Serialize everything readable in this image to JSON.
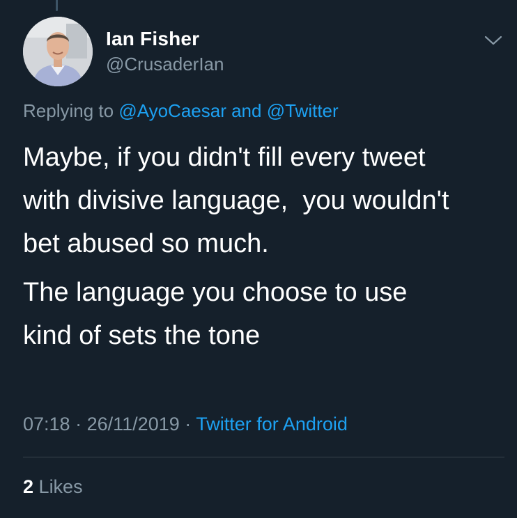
{
  "tweet": {
    "author_name": "Ian Fisher",
    "author_handle": "@CrusaderIan",
    "replying_prefix": "Replying to",
    "reply_to_1": "@AyoCaesar",
    "reply_joiner": "and",
    "reply_to_2": "@Twitter",
    "paragraph_1": "Maybe, if you didn't fill every tweet\nwith divisive language,  you wouldn't\nbet abused so much.",
    "paragraph_2": "The language you choose to use\nkind of sets the tone",
    "time": "07:18",
    "separator": "·",
    "date": "26/11/2019",
    "source": "Twitter for Android",
    "likes_count": "2",
    "likes_label": "Likes"
  },
  "icons": {
    "menu": "chevron-down-icon",
    "avatar": "profile-photo"
  },
  "colors": {
    "background": "#15202b",
    "link": "#1da1f2",
    "secondary_text": "#8899a6",
    "divider": "#38444d"
  }
}
